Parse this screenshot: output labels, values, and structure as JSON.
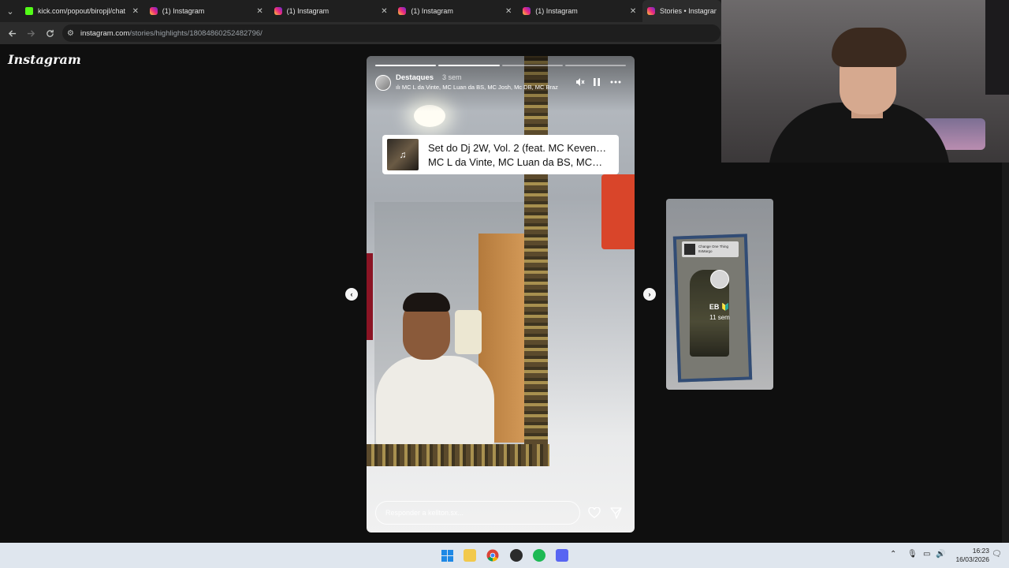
{
  "tabs": [
    {
      "title": "kick.com/popout/biropjl/chat",
      "favicon": "kick-icon"
    },
    {
      "title": "(1) Instagram",
      "favicon": "instagram-icon"
    },
    {
      "title": "(1) Instagram",
      "favicon": "instagram-icon"
    },
    {
      "title": "(1) Instagram",
      "favicon": "instagram-icon"
    },
    {
      "title": "(1) Instagram",
      "favicon": "instagram-icon"
    },
    {
      "title": "Stories • Instagram",
      "favicon": "instagram-icon"
    }
  ],
  "address_bar": {
    "host": "instagram.com",
    "path": "/stories/highlights/18084860252482796/"
  },
  "page": {
    "logo": "Instagram"
  },
  "story": {
    "username": "Destaques",
    "age": "3 sem",
    "music_line": "MC L da Vinte, MC Luan da BS, MC Josh, Mc DB, MC Braz",
    "segments_total": 4,
    "segments_done": 2,
    "song_title": "Set do Dj 2W, Vol. 2 (feat. MC Keven…",
    "song_artists": "MC L da Vinte, MC Luan da BS, MC…",
    "reply_placeholder": "Responder a kellton.sx..."
  },
  "next_story": {
    "username": "EB 🔰",
    "age": "11 sem",
    "card_text": "Change One Thing\nItsMargo"
  },
  "taskbar": {
    "apps": [
      "windows-start-icon",
      "file-explorer-icon",
      "chrome-icon",
      "obs-icon",
      "spotify-icon",
      "discord-icon"
    ],
    "time": "16:23",
    "date": "16/03/2026"
  },
  "colors": {
    "tab_bar": "#1f1f1f",
    "active_tab": "#2c2c2c",
    "page_bg": "#0f0f0f",
    "taskbar": "#dfe6ee"
  }
}
